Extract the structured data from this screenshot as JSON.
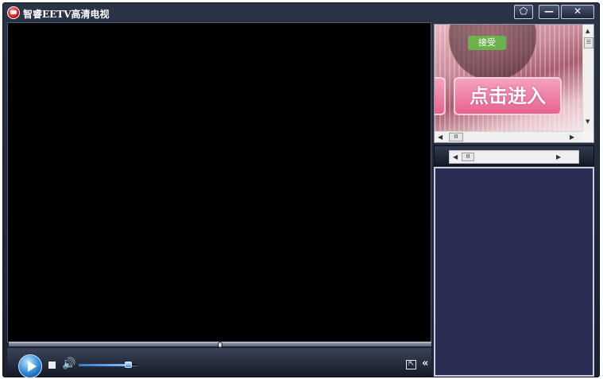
{
  "window": {
    "title": "智睿EETV高清电视",
    "icon": "app-logo-icon"
  },
  "titlebar_buttons": {
    "skin_icon": "skin-icon",
    "minimize_label": "—",
    "close_label": "✕"
  },
  "player": {
    "seek_position": 0.5,
    "volume_level": 0.85,
    "play_icon": "play-icon",
    "stop_icon": "stop-icon",
    "volume_icon_glyph": "🔊",
    "fullscreen_glyph": "⇱",
    "collapse_glyph": "«"
  },
  "ad": {
    "accept_label": "接受",
    "enter_label": "点击进入",
    "vscroll_up": "▲",
    "vscroll_down": "▼",
    "vscroll_thumb": "☰",
    "hscroll_left": "◀",
    "hscroll_right": "▶",
    "hscroll_thumb": "Ⅲ"
  },
  "strip": {
    "left_arrow": "◀",
    "right_arrow": "▶",
    "thumb": "Ⅲ"
  },
  "colors": {
    "window_bg": "#1c2232",
    "video_bg": "#000000",
    "playlist_bg": "#2a2d52",
    "accent_blue": "#2c89d9"
  }
}
